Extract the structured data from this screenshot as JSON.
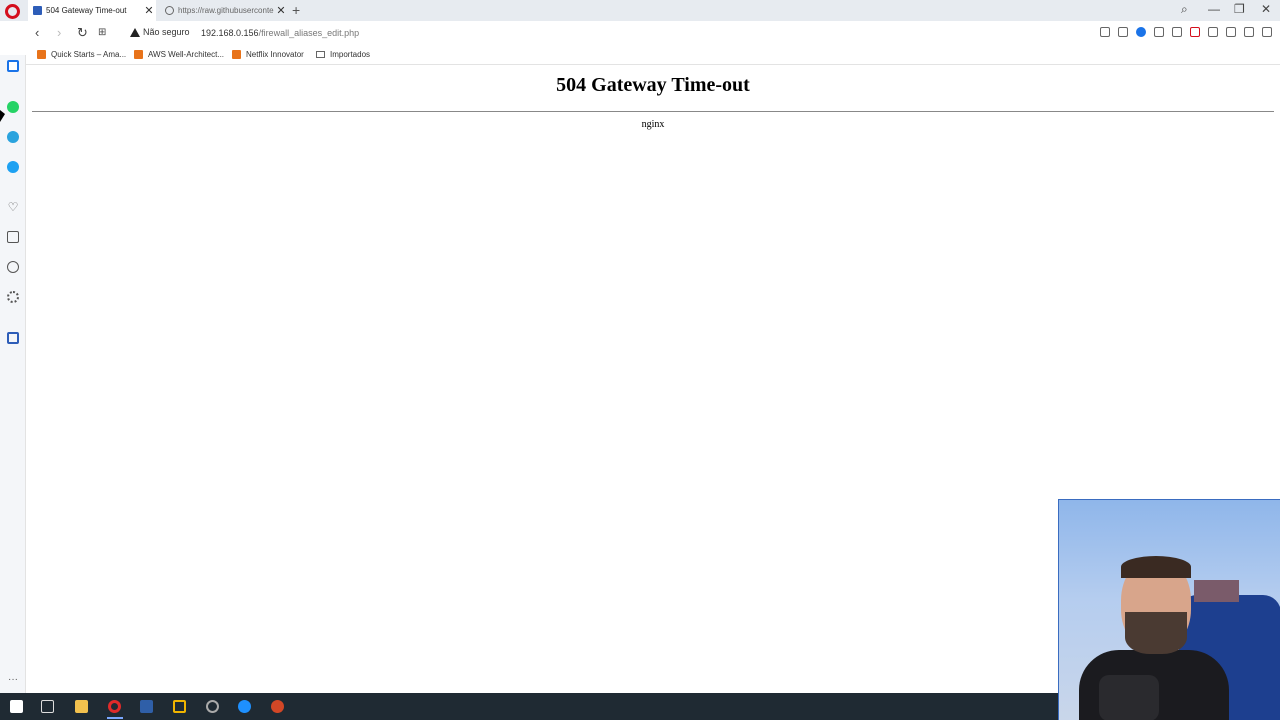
{
  "tabs": [
    {
      "title": "504 Gateway Time-out",
      "active": true
    },
    {
      "title": "https://raw.githubuserconte",
      "active": false
    }
  ],
  "address": {
    "security_label": "Não seguro",
    "url_host": "192.168.0.156",
    "url_path": "/firewall_aliases_edit.php"
  },
  "bookmarks": [
    {
      "label": "Quick Starts – Ama..."
    },
    {
      "label": "AWS Well-Architect..."
    },
    {
      "label": "Netflix Innovator"
    },
    {
      "label": "Importados"
    }
  ],
  "page": {
    "title": "504 Gateway Time-out",
    "server": "nginx"
  },
  "colors": {
    "opera_red": "#d40f1d",
    "accent_blue": "#1a73e8"
  }
}
